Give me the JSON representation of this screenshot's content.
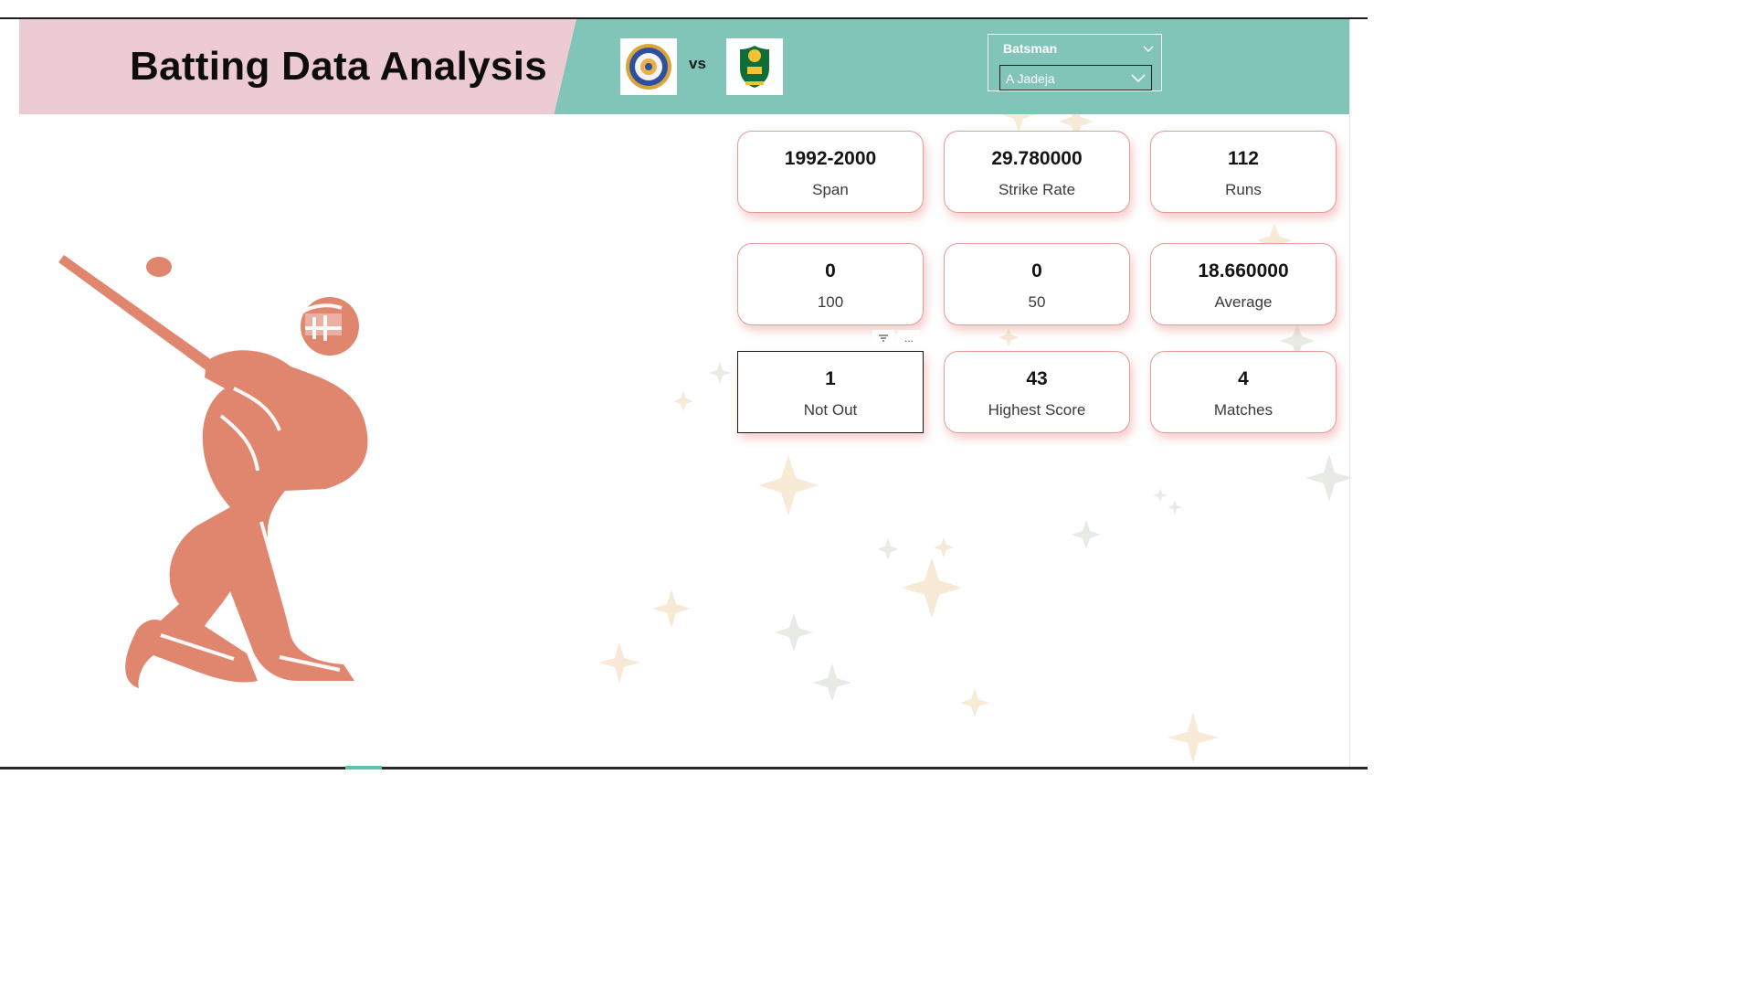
{
  "header": {
    "title": "Batting Data Analysis",
    "vs_label": "vs",
    "team1_logo": "india-crest-icon",
    "team2_logo": "south-africa-crest-icon"
  },
  "slicer": {
    "title": "Batsman",
    "selected": "A Jadeja"
  },
  "kpis": [
    {
      "value": "1992-2000",
      "label": "Span"
    },
    {
      "value": "29.780000",
      "label": "Strike Rate"
    },
    {
      "value": "112",
      "label": "Runs"
    },
    {
      "value": "0",
      "label": "100"
    },
    {
      "value": "0",
      "label": "50"
    },
    {
      "value": "18.660000",
      "label": "Average"
    },
    {
      "value": "1",
      "label": "Not Out"
    },
    {
      "value": "43",
      "label": "Highest Score"
    },
    {
      "value": "4",
      "label": "Matches"
    }
  ],
  "visual_header": {
    "filter_icon": "filter-icon",
    "more_icon": "more-options-icon",
    "more_text": "..."
  },
  "colors": {
    "header_teal": "#80c5b7",
    "header_pink": "#eccbd3",
    "card_border": "#e59b96",
    "batsman_fill": "#e0866f"
  }
}
